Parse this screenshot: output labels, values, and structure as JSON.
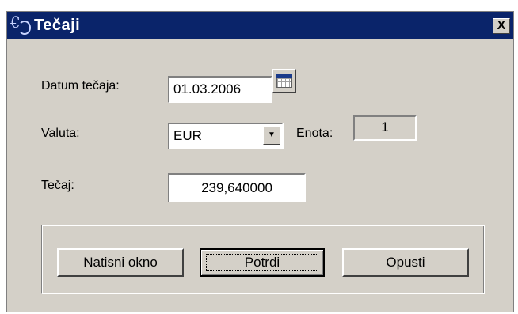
{
  "window": {
    "title": "Tečaji",
    "icon": "euro-coin-icon",
    "close_label": "X"
  },
  "form": {
    "date_label": "Datum tečaja:",
    "date_value": "01.03.2006",
    "currency_label": "Valuta:",
    "currency_value": "EUR",
    "unit_label": "Enota:",
    "unit_value": "1",
    "rate_label": "Tečaj:",
    "rate_value": "239,640000"
  },
  "buttons": {
    "print": "Natisni okno",
    "confirm": "Potrdi",
    "cancel": "Opusti"
  },
  "colors": {
    "titlebar": "#0a246a",
    "face": "#d4d0c8"
  }
}
